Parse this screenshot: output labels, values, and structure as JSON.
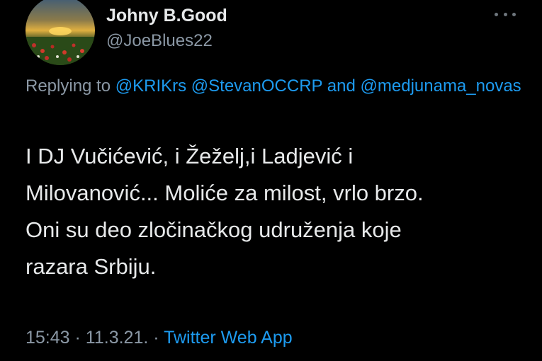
{
  "colors": {
    "background": "#000000",
    "primary_text": "#e7e9ea",
    "secondary_text": "#8b98a5",
    "accent": "#1d9bf0"
  },
  "author": {
    "display_name": "Johny B.Good",
    "handle": "@JoeBlues22",
    "avatar_icon": "landscape-avatar"
  },
  "more_menu": {
    "icon": "more-horizontal-icon"
  },
  "reply": {
    "prefix": "Replying to",
    "mentions": [
      "@KRIKrs",
      "@StevanOCCRP",
      "@medjunama_novas"
    ],
    "conjunction": "and"
  },
  "tweet": {
    "lines": [
      "I DJ Vučićević, i Žeželj,i Ladjević i",
      "Milovanović... Moliće za milost, vrlo brzo.",
      "Oni su deo zločinačkog udruženja koje",
      "razara Srbiju."
    ]
  },
  "meta": {
    "time": "15:43",
    "separator": "·",
    "date": "11.3.21.",
    "source": "Twitter Web App"
  }
}
